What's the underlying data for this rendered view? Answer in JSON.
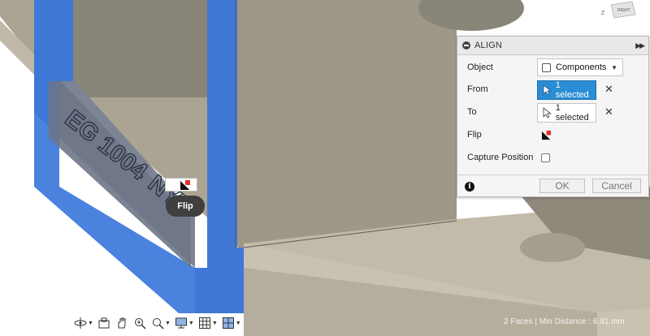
{
  "dialog": {
    "title": "ALIGN",
    "rows": {
      "object": {
        "label": "Object",
        "value": "Components"
      },
      "from": {
        "label": "From",
        "value": "1 selected"
      },
      "to": {
        "label": "To",
        "value": "1 selected"
      },
      "flip": {
        "label": "Flip"
      },
      "capture": {
        "label": "Capture Position",
        "checked": false
      }
    },
    "ok_label": "OK",
    "cancel_label": "Cancel",
    "info_glyph": "i"
  },
  "canvas": {
    "tooltip": "Flip",
    "engraving_text": "EG 1004",
    "engraving_logo": "NYU",
    "viewcube_label": "RIGHT",
    "viewcube_axis": "Z"
  },
  "status_bar": {
    "text": "2 Faces | Min Distance : 6.91 mm"
  },
  "toolbar": {
    "icons": [
      "orbit-icon",
      "look-at-icon",
      "pan-icon",
      "zoom-window-icon",
      "zoom-icon",
      "display-settings-icon",
      "grid-icon",
      "viewports-icon"
    ]
  },
  "colors": {
    "selection_blue": "#3f78d6",
    "active_field": "#2a8dd6",
    "body_surface": "#a7a091",
    "background": "#ffffff"
  }
}
